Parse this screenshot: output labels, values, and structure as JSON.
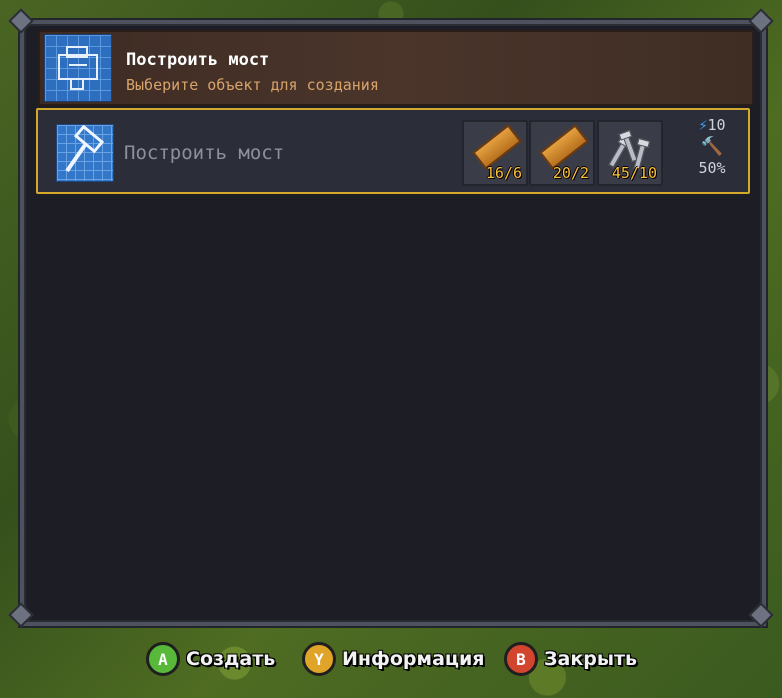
{
  "header": {
    "title": "Построить мост",
    "subtitle": "Выберите объект для создания",
    "icon": "blueprint-icon"
  },
  "recipe": {
    "name": "Построить мост",
    "icon": "hammer-blueprint-icon",
    "materials": [
      {
        "icon": "wood-plank-icon",
        "count": "16/6"
      },
      {
        "icon": "wood-plank-icon",
        "count": "20/2"
      },
      {
        "icon": "nails-icon",
        "count": "45/10"
      }
    ],
    "energy": "10",
    "success_chance": "50%"
  },
  "buttons": {
    "create": {
      "key": "A",
      "label": "Создать",
      "color": "#58b83a"
    },
    "info": {
      "key": "Y",
      "label": "Информация",
      "color": "#e0a428"
    },
    "close": {
      "key": "B",
      "label": "Закрыть",
      "color": "#d2452e"
    }
  },
  "colors": {
    "selection_border": "#d4a82a",
    "material_count": "#ffbf3a",
    "subtitle": "#d8a46a"
  }
}
